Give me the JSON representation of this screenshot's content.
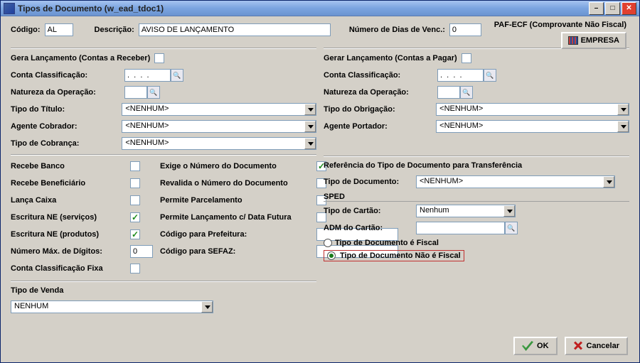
{
  "window": {
    "title": "Tipos de Documento (w_ead_tdoc1)"
  },
  "paf": {
    "text": "PAF-ECF (Comprovante Não Fiscal)",
    "empresa_btn": "EMPRESA"
  },
  "top": {
    "codigo_label": "Código:",
    "codigo_value": "AL",
    "descricao_label": "Descrição:",
    "descricao_value": "AVISO DE LANÇAMENTO",
    "dias_label": "Número de Dias de Venc.:",
    "dias_value": "0"
  },
  "receber": {
    "title": "Gera Lançamento (Contas a Receber)",
    "conta_label": "Conta Classificação:",
    "conta_value": ".  .  .  .",
    "natureza_label": "Natureza da Operação:",
    "tipo_titulo_label": "Tipo do Título:",
    "tipo_titulo_value": "<NENHUM>",
    "agente_label": "Agente Cobrador:",
    "agente_value": "<NENHUM>",
    "tipo_cobranca_label": "Tipo de Cobrança:",
    "tipo_cobranca_value": "<NENHUM>"
  },
  "pagar": {
    "title": "Gerar Lançamento (Contas a Pagar)",
    "conta_label": "Conta Classificação:",
    "conta_value": ".  .  .  .",
    "natureza_label": "Natureza da Operação:",
    "tipo_obrig_label": "Tipo do Obrigação:",
    "tipo_obrig_value": "<NENHUM>",
    "agente_label": "Agente Portador:",
    "agente_value": "<NENHUM>"
  },
  "chk_left": {
    "recebe_banco": "Recebe Banco",
    "recebe_benef": "Recebe Beneficiário",
    "lanca_caixa": "Lança Caixa",
    "escritura_serv": "Escritura NE (serviços)",
    "escritura_prod": "Escritura NE (produtos)",
    "num_max": "Número Máx. de Dígitos:",
    "num_max_value": "0",
    "conta_fixa": "Conta Classificação Fixa"
  },
  "chk_right": {
    "exige_num": "Exige o Número do Documento",
    "revalida": "Revalida o Número do Documento",
    "permite_parc": "Permite Parcelamento",
    "permite_lanc": "Permite Lançamento c/ Data Futura",
    "cod_pref": "Código para Prefeitura:",
    "cod_sefaz": "Código para SEFAZ:"
  },
  "ref": {
    "title": "Referência do Tipo de Documento para Transferência",
    "tipo_doc_label": "Tipo de Documento:",
    "tipo_doc_value": "<NENHUM>",
    "sped": "SPED",
    "tipo_cartao_label": "Tipo de Cartão:",
    "tipo_cartao_value": "Nenhum",
    "adm_label": "ADM  do Cartão:",
    "radio_fiscal": "Tipo de Documento é Fiscal",
    "radio_nao_fiscal": "Tipo de Documento Não é Fiscal"
  },
  "venda": {
    "title": "Tipo de Venda",
    "value": "NENHUM"
  },
  "buttons": {
    "ok": "OK",
    "cancel": "Cancelar"
  }
}
